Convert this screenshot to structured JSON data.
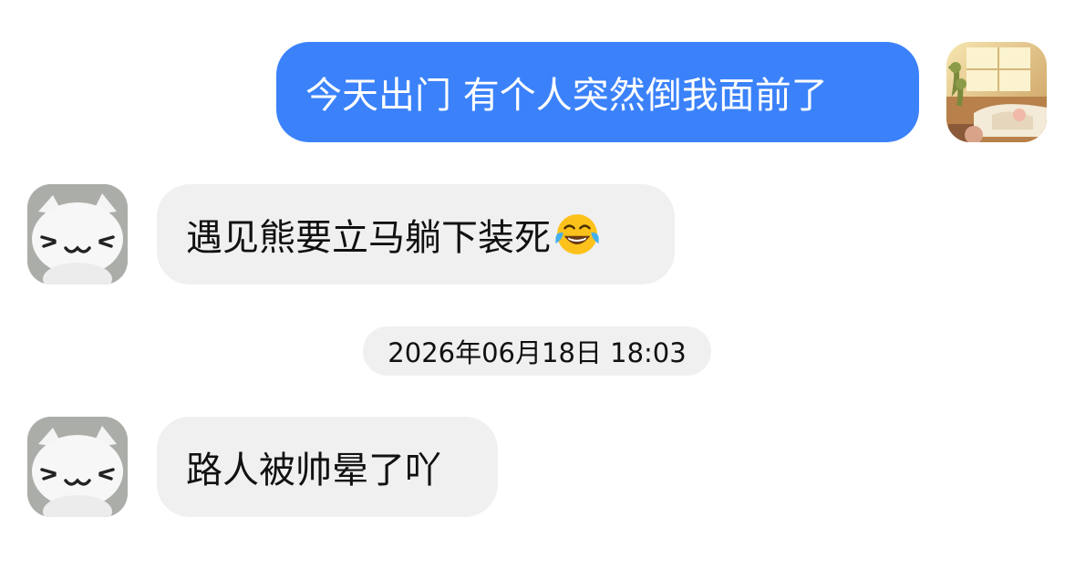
{
  "chat": {
    "messages": [
      {
        "direction": "outgoing",
        "text": "今天出门 有个人突然倒我面前了",
        "avatar": "user-room-illustration"
      },
      {
        "direction": "incoming",
        "text": "遇见熊要立马躺下装死",
        "emoji": "face-with-tears-of-joy",
        "avatar": "white-cat-plush"
      },
      {
        "direction": "incoming",
        "text": "路人被帅晕了吖",
        "avatar": "white-cat-plush"
      }
    ],
    "timestamp": "2026年06月18日 18:03"
  },
  "colors": {
    "outgoing_bubble": "#3b82fa",
    "incoming_bubble": "#f0f0f0",
    "timestamp_pill": "#f0f0f0",
    "background": "#ffffff"
  }
}
